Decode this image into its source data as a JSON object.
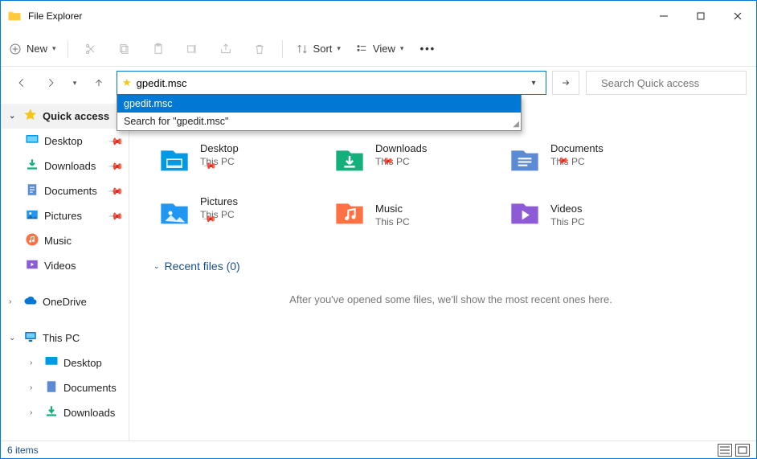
{
  "title": "File Explorer",
  "toolbar": {
    "new": "New",
    "sort": "Sort",
    "view": "View"
  },
  "address": {
    "value": "gpedit.msc",
    "suggestion_selected": "gpedit.msc",
    "suggestion_search": "Search for \"gpedit.msc\""
  },
  "search": {
    "placeholder": "Search Quick access"
  },
  "sidebar": {
    "quick_access": "Quick access",
    "desktop": "Desktop",
    "downloads": "Downloads",
    "documents": "Documents",
    "pictures": "Pictures",
    "music": "Music",
    "videos": "Videos",
    "onedrive": "OneDrive",
    "this_pc": "This PC",
    "tp_desktop": "Desktop",
    "tp_documents": "Documents",
    "tp_downloads": "Downloads"
  },
  "folders": [
    {
      "name": "Desktop",
      "sub": "This PC",
      "pinned": true,
      "color": "#0099e5",
      "glyph": "desktop"
    },
    {
      "name": "Downloads",
      "sub": "This PC",
      "pinned": true,
      "color": "#14b07b",
      "glyph": "download"
    },
    {
      "name": "Documents",
      "sub": "This PC",
      "pinned": true,
      "color": "#5b8bd4",
      "glyph": "doc"
    },
    {
      "name": "Pictures",
      "sub": "This PC",
      "pinned": true,
      "color": "#2196f3",
      "glyph": "picture"
    },
    {
      "name": "Music",
      "sub": "This PC",
      "pinned": false,
      "color": "#ff7043",
      "glyph": "music"
    },
    {
      "name": "Videos",
      "sub": "This PC",
      "pinned": false,
      "color": "#8e5bd6",
      "glyph": "video"
    }
  ],
  "recent": {
    "header": "Recent files (0)",
    "empty": "After you've opened some files, we'll show the most recent ones here."
  },
  "status": {
    "count": "6 items"
  }
}
